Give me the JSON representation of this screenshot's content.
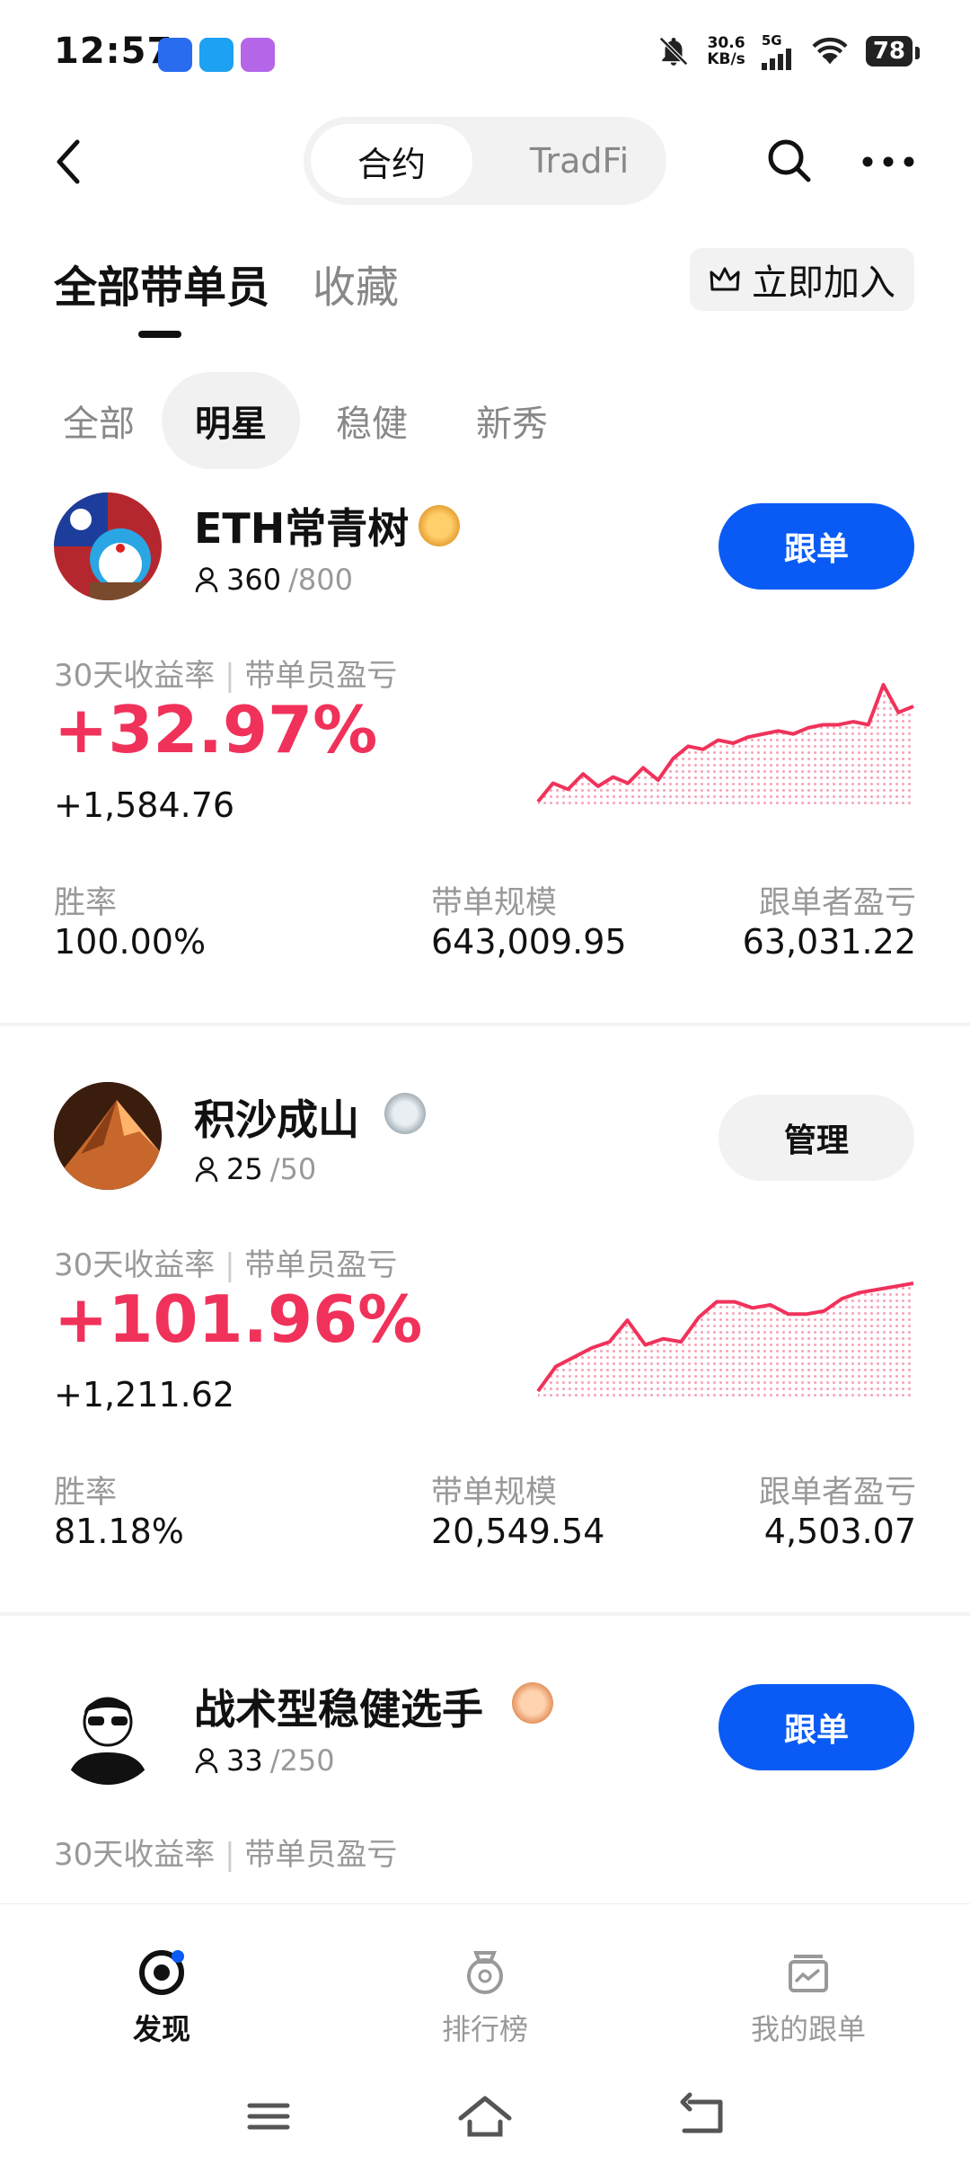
{
  "status_bar": {
    "time": "12:57",
    "net_speed": "30.6",
    "net_unit": "KB/s",
    "signal": "5G",
    "battery": "78"
  },
  "header": {
    "segments": [
      "合约",
      "TradFi"
    ],
    "icons": [
      "back-icon",
      "search-icon",
      "more-icon"
    ]
  },
  "tabs": {
    "primary": "全部带单员",
    "secondary": "收藏",
    "join_label": "立即加入"
  },
  "filters": [
    "全部",
    "明星",
    "稳健",
    "新秀"
  ],
  "labels": {
    "profit_rate": "30天收益率",
    "leader_pnl": "带单员盈亏",
    "win_rate": "胜率",
    "aum": "带单规模",
    "follower_pnl": "跟单者盈亏"
  },
  "traders": [
    {
      "name": "ETH常青树",
      "badge": "gold",
      "followers": "360",
      "capacity": "/800",
      "action": "跟单",
      "roi": "+32.97%",
      "pnl": "+1,584.76",
      "win_rate": "100.00%",
      "aum": "643,009.95",
      "follower_pnl": "63,031.22"
    },
    {
      "name": "积沙成山",
      "badge": "silver",
      "followers": "25",
      "capacity": "/50",
      "action": "管理",
      "roi": "+101.96%",
      "pnl": "+1,211.62",
      "win_rate": "81.18%",
      "aum": "20,549.54",
      "follower_pnl": "4,503.07"
    },
    {
      "name": "战术型稳健选手",
      "badge": "bronze",
      "followers": "33",
      "capacity": "/250",
      "action": "跟单"
    }
  ],
  "sparklines": [
    [
      2,
      8,
      6,
      11,
      7,
      10,
      8,
      13,
      9,
      16,
      20,
      19,
      22,
      21,
      23,
      24,
      25,
      24,
      26,
      27,
      27,
      28,
      27,
      40,
      31,
      33
    ],
    [
      2,
      10,
      13,
      16,
      18,
      25,
      17,
      19,
      18,
      26,
      31,
      31,
      29,
      30,
      27,
      27,
      28,
      32,
      34,
      35,
      36,
      37
    ]
  ],
  "colors": {
    "accent_red": "#f0325b",
    "brand_blue": "#0a5bf5"
  },
  "bottom_nav": [
    {
      "label": "发现",
      "icon": "discover-icon",
      "active": true
    },
    {
      "label": "排行榜",
      "icon": "ranking-icon",
      "active": false
    },
    {
      "label": "我的跟单",
      "icon": "my-copy-icon",
      "active": false
    }
  ]
}
